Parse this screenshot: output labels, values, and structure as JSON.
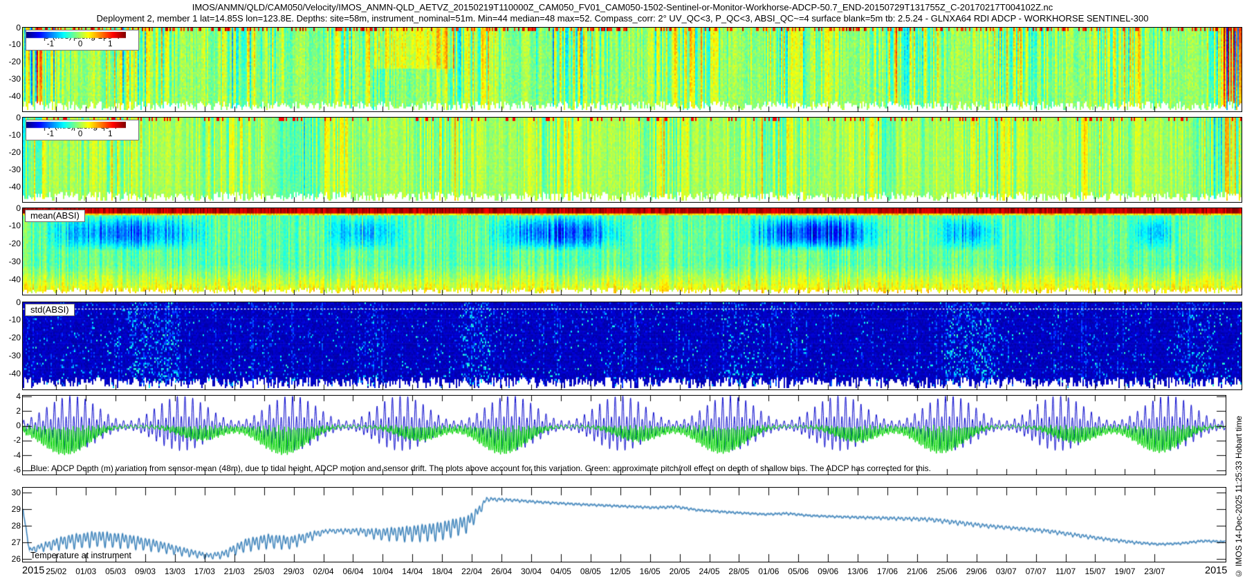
{
  "header": {
    "line1": "IMOS/ANMN/QLD/CAM050/Velocity/IMOS_ANMN-QLD_AETVZ_20150219T110000Z_CAM050_FV01_CAM050-1502-Sentinel-or-Monitor-Workhorse-ADCP-50.7_END-20150729T131755Z_C-20170217T004102Z.nc",
    "line2": "Deployment 2, member 1 lat=14.85S lon=123.8E. Depths: site=58m, instrument_nominal=51m. Min=44 median=48 max=52. Compass_corr: 2° UV_QC<3, P_QC<3, ABSI_QC~=4 surface blank=5m tb: 2.5.24 - GLNXA64 RDI ADCP - WORKHORSE SENTINEL-300"
  },
  "watermark": "© IMOS 14-Dec-2025 11:25:33 Hobart time",
  "x_axis": {
    "year_left": "2015",
    "year_right": "2015",
    "first_tick_day": 4.5,
    "tick_interval_days": 4,
    "date_ticks": [
      "25/02",
      "01/03",
      "05/03",
      "09/03",
      "13/03",
      "17/03",
      "21/03",
      "25/03",
      "29/03",
      "02/04",
      "06/04",
      "10/04",
      "14/04",
      "18/04",
      "22/04",
      "26/04",
      "30/04",
      "04/05",
      "08/05",
      "12/05",
      "16/05",
      "20/05",
      "24/05",
      "28/05",
      "01/06",
      "05/06",
      "09/06",
      "13/06",
      "17/06",
      "21/06",
      "25/06",
      "29/06",
      "03/07",
      "07/07",
      "11/07",
      "15/07",
      "19/07",
      "23/07"
    ]
  },
  "chart_data": [
    {
      "id": "u_velocity",
      "type": "heatmap",
      "title": "U (m/s) along 158°T",
      "colormap": "jet",
      "value_range": [
        -1.7,
        1.7
      ],
      "colorbar_ticks": [
        "-1",
        "0",
        "1"
      ],
      "colorbar_tick_fracs": [
        0.18,
        0.48,
        0.78
      ],
      "ylim": [
        -48.5,
        0
      ],
      "yticks": [
        0,
        -10,
        -20,
        -30,
        -40
      ],
      "notes": "Dense semidiurnal vertical striping, mostly green near 0 m/s; strong blue/red extremes at deployment start and end; positive (yellow) band near days 48-58."
    },
    {
      "id": "v_velocity",
      "type": "heatmap",
      "title": "V (m/s) along 68°T",
      "colormap": "jet",
      "value_range": [
        -1.7,
        1.7
      ],
      "colorbar_ticks": [
        "-1",
        "0",
        "1"
      ],
      "colorbar_tick_fracs": [
        0.18,
        0.48,
        0.78
      ],
      "ylim": [
        -48.5,
        0
      ],
      "yticks": [
        0,
        -10,
        -20,
        -30,
        -40
      ],
      "notes": "Smoother green field than U, weak semidiurnal striping, darker patch near days 32-41."
    },
    {
      "id": "mean_absi",
      "type": "heatmap",
      "label": "mean(ABSI)",
      "colormap": "jet",
      "ylim": [
        -48.5,
        0
      ],
      "yticks": [
        0,
        -10,
        -20,
        -30,
        -40
      ],
      "surface_band": "high backscatter (red/orange) in top ~3 m",
      "low_patches_days": [
        [
          2,
          26,
          0.55
        ],
        [
          40,
          52,
          0.35
        ],
        [
          62,
          82,
          0.6
        ],
        [
          96,
          117,
          0.75
        ],
        [
          122,
          132,
          0.45
        ],
        [
          149,
          156,
          0.3
        ]
      ],
      "notes": "Green background, cyan/blue low-backscatter patches at 8-22 m depth, yellow-green near bottom."
    },
    {
      "id": "std_absi",
      "type": "heatmap",
      "label": "std(ABSI)",
      "colormap": "jet",
      "ylim": [
        -48.5,
        0
      ],
      "yticks": [
        0,
        -10,
        -20,
        -30,
        -40
      ],
      "dotted_line_depth_m": -3.5,
      "bright_clusters_days": [
        [
          14,
          21,
          0.9
        ],
        [
          45,
          48,
          0.4
        ],
        [
          59,
          63,
          0.8
        ],
        [
          94,
          100,
          0.5
        ],
        [
          124,
          131,
          0.9
        ],
        [
          155,
          160,
          0.5
        ]
      ],
      "notes": "Dark navy field (low std) with sparse lighter blue streaks; white dotted line near -3.5 m."
    },
    {
      "id": "depth_variation",
      "type": "line",
      "ylim": [
        -6.6,
        4.1
      ],
      "yticks": [
        4,
        2,
        0,
        -2,
        -4,
        -6
      ],
      "series": [
        {
          "name": "adcp_depth_variation_m",
          "color": "#0000cc"
        },
        {
          "name": "pitch_roll_effect_m",
          "color": "#00d400"
        }
      ],
      "tide": {
        "amp_base": 0.62,
        "amp_mod": 1.5,
        "spring_neap_days": 14.77,
        "semidiurnal_period_days": 0.5175
      },
      "note": "Blue: ADCP Depth (m) variation from sensor-mean (48m), due to tidal height, ADCP motion and sensor drift. The plots above account for this variation. Green: approximate pitch/roll effect on depth of shallow bins. The ADCP has corrected for this."
    },
    {
      "id": "temperature",
      "type": "line",
      "label": "Temperature at instrument",
      "color": "#1b6eb0",
      "ylim": [
        25.85,
        30.3
      ],
      "yticks": [
        30,
        29,
        28,
        27,
        26
      ],
      "waypoints_day_degC_amp": [
        [
          0,
          29.0,
          0.05
        ],
        [
          0.9,
          26.55,
          0.15
        ],
        [
          3,
          26.8,
          0.3
        ],
        [
          6,
          27.1,
          0.5
        ],
        [
          10,
          27.3,
          0.55
        ],
        [
          14,
          27.15,
          0.5
        ],
        [
          18,
          26.85,
          0.4
        ],
        [
          22,
          26.45,
          0.28
        ],
        [
          25,
          26.2,
          0.18
        ],
        [
          27,
          26.3,
          0.25
        ],
        [
          30,
          26.9,
          0.45
        ],
        [
          33,
          27.15,
          0.5
        ],
        [
          36,
          27.05,
          0.45
        ],
        [
          39,
          27.45,
          0.3
        ],
        [
          41,
          27.7,
          0.12
        ],
        [
          45,
          27.7,
          0.2
        ],
        [
          48,
          27.55,
          0.4
        ],
        [
          52,
          27.6,
          0.55
        ],
        [
          56,
          27.75,
          0.65
        ],
        [
          60,
          28.2,
          0.6
        ],
        [
          61.5,
          28.95,
          0.35
        ],
        [
          62.5,
          29.62,
          0.12
        ],
        [
          66,
          29.55,
          0.08
        ],
        [
          70,
          29.42,
          0.07
        ],
        [
          75,
          29.3,
          0.06
        ],
        [
          80,
          29.2,
          0.06
        ],
        [
          85,
          29.1,
          0.07
        ],
        [
          88,
          29.15,
          0.08
        ],
        [
          91,
          28.95,
          0.06
        ],
        [
          96,
          28.8,
          0.06
        ],
        [
          100,
          28.7,
          0.05
        ],
        [
          103,
          28.75,
          0.07
        ],
        [
          106,
          28.62,
          0.05
        ],
        [
          110,
          28.55,
          0.06
        ],
        [
          114,
          28.5,
          0.08
        ],
        [
          118,
          28.45,
          0.1
        ],
        [
          122,
          28.4,
          0.12
        ],
        [
          126,
          28.2,
          0.14
        ],
        [
          130,
          28.0,
          0.12
        ],
        [
          134,
          27.85,
          0.1
        ],
        [
          138,
          27.7,
          0.12
        ],
        [
          142,
          27.45,
          0.12
        ],
        [
          146,
          27.2,
          0.1
        ],
        [
          150,
          27.0,
          0.08
        ],
        [
          153,
          26.9,
          0.06
        ],
        [
          156,
          26.95,
          0.06
        ],
        [
          159,
          27.1,
          0.07
        ],
        [
          162,
          27.05,
          0.05
        ]
      ]
    }
  ]
}
